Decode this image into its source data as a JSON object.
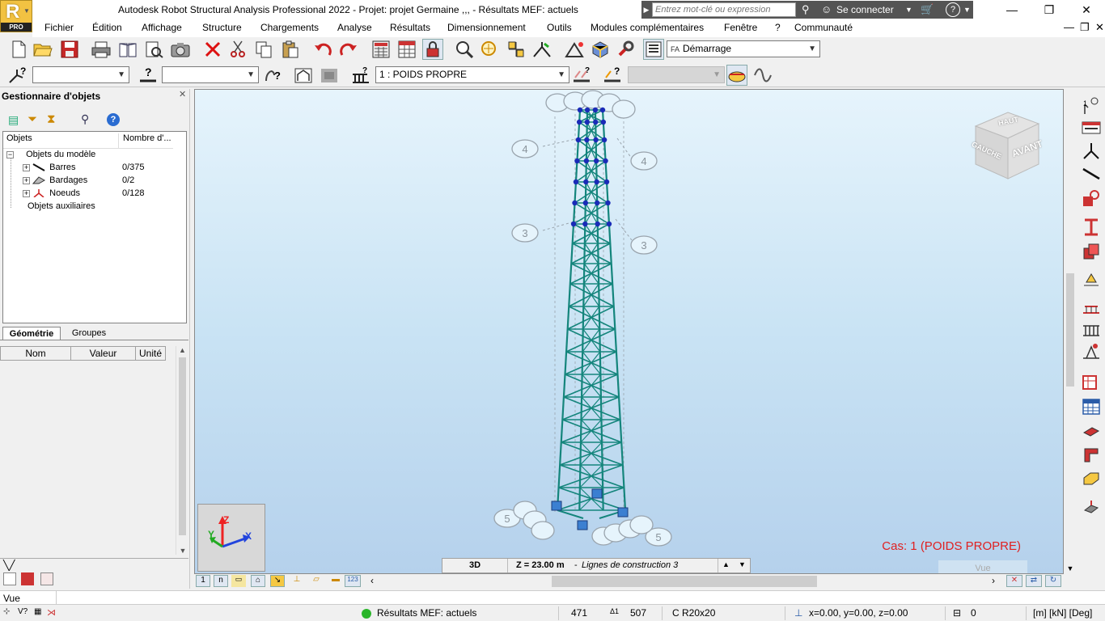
{
  "window": {
    "title": "Autodesk Robot Structural Analysis Professional 2022 - Projet: projet Germaine ,,, - Résultats MEF: actuels",
    "logo_letter": "R",
    "logo_badge": "PRO",
    "search_placeholder": "Entrez mot-clé ou expression",
    "login_label": "Se connecter",
    "help_label": "?",
    "controls": {
      "minimize": "—",
      "restore": "❐",
      "close": "✕"
    }
  },
  "menu": {
    "items": [
      "Fichier",
      "Édition",
      "Affichage",
      "Structure",
      "Chargements",
      "Analyse",
      "Résultats",
      "Dimensionnement",
      "Outils",
      "Modules complémentaires",
      "Fenêtre",
      "?",
      "Communauté"
    ],
    "mdi": {
      "minimize": "—",
      "restore": "❐",
      "close": "✕"
    }
  },
  "toolbar1": {
    "layout_combo": "Démarrage",
    "layout_prefix": "FA"
  },
  "toolbar2": {
    "combo1": "",
    "combo2": "",
    "load_case": "1 : POIDS PROPRE",
    "combo4": ""
  },
  "object_manager": {
    "title": "Gestionnaire d'objets",
    "col_objects": "Objets",
    "col_count": "Nombre d'...",
    "tree": [
      {
        "label": "Objets du modèle",
        "count": "",
        "level": 0
      },
      {
        "label": "Barres",
        "count": "0/375",
        "level": 1
      },
      {
        "label": "Bardages",
        "count": "0/2",
        "level": 1
      },
      {
        "label": "Noeuds",
        "count": "0/128",
        "level": 1
      },
      {
        "label": "Objets auxiliaires",
        "count": "",
        "level": 0
      }
    ],
    "tabs": [
      "Géométrie",
      "Groupes"
    ],
    "prop_headers": [
      "Nom",
      "Valeur",
      "Unité"
    ]
  },
  "viewport": {
    "case_label": "Cas: 1 (POIDS PROPRE)",
    "view_label": "Vue",
    "view_mode": "3D",
    "context": "Z = 23.00 m",
    "context_suffix": "Lignes de construction 3",
    "viewcube_top": "HAUT",
    "viewcube_front": "AVANT",
    "viewcube_left": "GAUCHE",
    "axis_labels": [
      "X",
      "Y",
      "Z"
    ],
    "grid_labels": [
      "4",
      "4",
      "3",
      "3",
      "5",
      "5"
    ]
  },
  "vue_bar": {
    "text": "Vue"
  },
  "status": {
    "results": "Résultats MEF: actuels",
    "nodes": "471",
    "bars": "507",
    "section": "C R20x20",
    "coords": "x=0.00, y=0.00, z=0.00",
    "angle": "0",
    "units": "[m] [kN] [Deg]"
  },
  "colors": {
    "tower": "#14857c",
    "accent": "#e02020",
    "node": "#1a2bb8",
    "support": "#3b7fd1"
  }
}
